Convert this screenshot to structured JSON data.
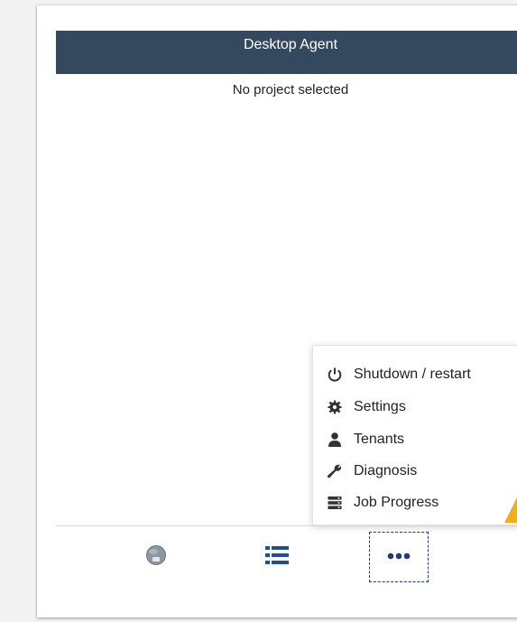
{
  "app": {
    "title": "Desktop Agent",
    "status_text": "No project selected"
  },
  "menu": {
    "items": [
      {
        "label": "Shutdown / restart",
        "icon": "power-icon"
      },
      {
        "label": "Settings",
        "icon": "gear-icon"
      },
      {
        "label": "Tenants",
        "icon": "user-icon"
      },
      {
        "label": "Diagnosis",
        "icon": "wrench-icon"
      },
      {
        "label": "Job Progress",
        "icon": "server-stack-icon"
      }
    ]
  },
  "bottom_tabs": [
    {
      "name": "projects",
      "icon": "disk-icon",
      "active": false
    },
    {
      "name": "list",
      "icon": "list-icon",
      "active": false
    },
    {
      "name": "more",
      "icon": "more-dots-icon",
      "active": true
    }
  ],
  "colors": {
    "header_bg": "#34495e",
    "accent_blue": "#1f3c6d",
    "caret": "#f0ad1c"
  }
}
